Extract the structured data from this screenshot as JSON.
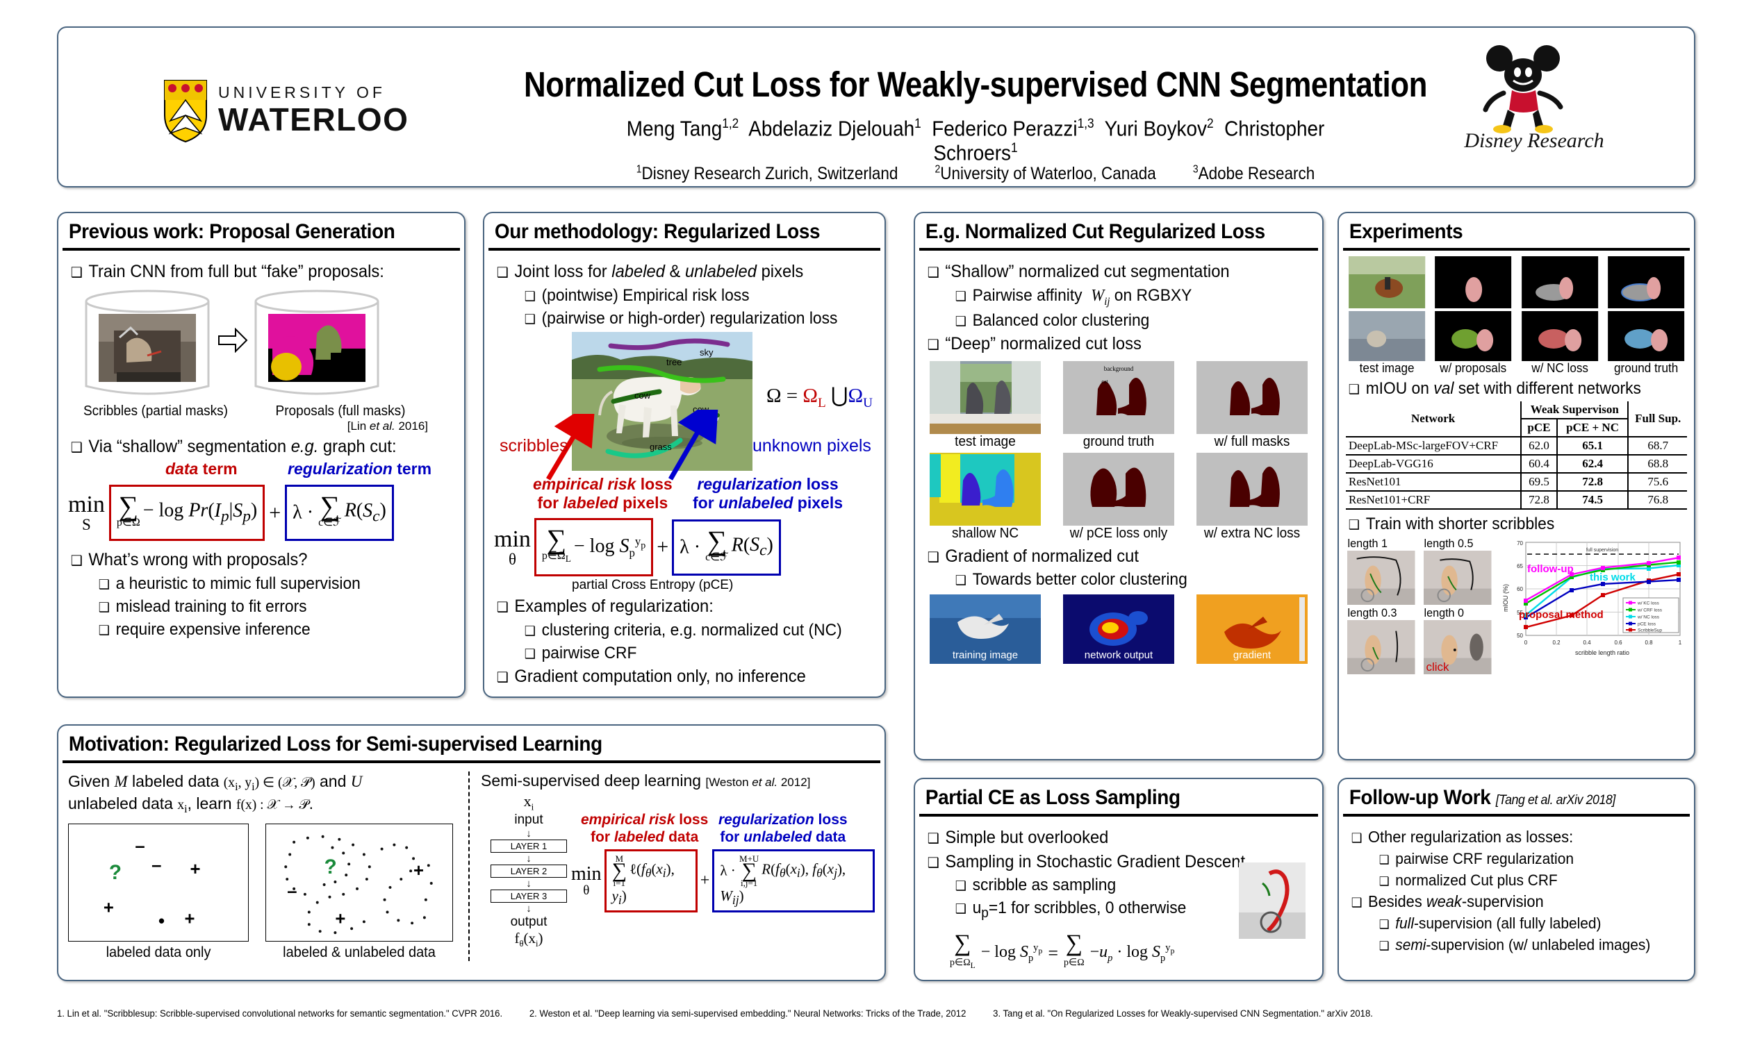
{
  "header": {
    "title": "Normalized Cut Loss for Weakly-supervised CNN Segmentation",
    "authors_line1": "Meng Tang1,2  Abdelaziz Djelouah1  Federico Perazzi1,3  Yuri Boykov2  Christopher",
    "authors_line2": "Schroers1",
    "affiliations": [
      "1Disney Research Zurich, Switzerland",
      "2University of Waterloo, Canada",
      "3Adobe Research"
    ],
    "uw_logo_line1": "UNIVERSITY OF",
    "uw_logo_line2": "WATERLOO",
    "disney_logo_text": "Disney Research"
  },
  "col1": {
    "title": "Previous work: Proposal Generation",
    "bullet1": "Train CNN from full but “fake” proposals:",
    "cap_left": "Scribbles (partial masks)",
    "cap_right": "Proposals (full masks)",
    "cap_right_cite": "[Lin et al. 2016]",
    "bullet2": "Via “shallow” segmentation e.g. graph cut:",
    "label_data": "data term",
    "label_reg": "regularization term",
    "formula_min": "min",
    "formula_sub": "S",
    "formula_red": "∑ − log Pr(Iₚ|Sₚ)",
    "formula_red_sub": "p∈Ω",
    "formula_plus": "+",
    "formula_blue": "λ · ∑ R(Sₑ)",
    "formula_blue_sub": "c∈ℱ",
    "bullet3": "What’s wrong with proposals?",
    "sub1": "a heuristic to mimic full supervision",
    "sub2": "mislead training to fit errors",
    "sub3": "require expensive inference"
  },
  "col2": {
    "title": "Our methodology: Regularized Loss",
    "bullet1": "Joint loss for labeled & unlabeled pixels",
    "sub1": "(pointwise) Empirical risk loss",
    "sub2": "(pairwise or high-order) regularization loss",
    "omega_eq": "Ω = ΩL ⋃ ΩU",
    "img_labels": [
      "sky",
      "tree",
      "cow",
      "cow",
      "grass"
    ],
    "scribbles_label": "scribbles",
    "unknown_label": "unknown pixels",
    "label_emp1": "empirical risk loss",
    "label_emp2": "for labeled pixels",
    "label_reg1": "regularization loss",
    "label_reg2": "for unlabeled pixels",
    "formula_min": "min",
    "formula_sub": "θ",
    "formula_red": "∑ − log Sₚ",
    "formula_red_sup": "yₚ",
    "formula_red_sub": "p∈ΩL",
    "formula_blue": "λ · ∑ R(Sₑ)",
    "formula_blue_sub": "c∈ℱ",
    "pce_caption": "partial Cross Entropy (pCE)",
    "bullet2": "Examples of regularization:",
    "sub3": "clustering criteria, e.g. normalized cut (NC)",
    "sub4": "pairwise CRF",
    "bullet3": "Gradient computation only, no inference"
  },
  "col3": {
    "title": "E.g. Normalized Cut Regularized Loss",
    "bullet1": "“Shallow” normalized cut segmentation",
    "sub1a": "Pairwise affinity ",
    "sub1b": "Wij",
    "sub1c": " on RGBXY",
    "sub2": "Balanced color clustering",
    "bullet2": "“Deep” normalized cut loss",
    "grid_captions": [
      "test image",
      "ground truth",
      "w/ full masks",
      "shallow NC",
      "w/ pCE loss only",
      "w/  extra NC loss"
    ],
    "gt_label": "background",
    "gt_label2": "cat",
    "bullet3": "Gradient of normalized cut",
    "sub3": "Towards better color clustering",
    "bottom_captions": [
      "training image",
      "network output",
      "gradient"
    ]
  },
  "col4": {
    "title": "Experiments",
    "row_captions": [
      "test image",
      "w/  proposals",
      "w/  NC loss",
      "ground truth"
    ],
    "bullet1": "mIOU on val set with different networks",
    "table": {
      "col_network": "Network",
      "col_weak": "Weak Supervison",
      "col_full": "Full Sup.",
      "sub_pce": "pCE",
      "sub_pce_nc": "pCE + NC",
      "rows": [
        {
          "network": "DeepLab-MSc-largeFOV+CRF",
          "pce": "62.0",
          "pce_nc": "65.1",
          "full": "68.7"
        },
        {
          "network": "DeepLab-VGG16",
          "pce": "60.4",
          "pce_nc": "62.4",
          "full": "68.8"
        },
        {
          "network": "ResNet101",
          "pce": "69.5",
          "pce_nc": "72.8",
          "full": "75.6"
        },
        {
          "network": "ResNet101+CRF",
          "pce": "72.8",
          "pce_nc": "74.5",
          "full": "76.8"
        }
      ]
    },
    "bullet2": "Train with shorter scribbles",
    "scribble_labels": [
      "length 1",
      "length 0.5",
      "length 0.3",
      "length 0"
    ],
    "click_label": "click",
    "annot_followup": "follow-up",
    "annot_thiswork": "this work",
    "annot_proposal": "proposal method"
  },
  "chart_data": {
    "type": "line",
    "title": "",
    "xlabel": "scribble length ratio",
    "ylabel": "mIOU (%)",
    "xlim": [
      0,
      1
    ],
    "ylim": [
      50,
      70
    ],
    "xticks": [
      "0",
      "0.2",
      "0.4",
      "0.6",
      "0.8",
      "1"
    ],
    "yticks": [
      "50",
      "55",
      "60",
      "65",
      "70"
    ],
    "grid": true,
    "legend_position": "lower right",
    "annotations": [
      {
        "text": "full supervision",
        "y": 68.7,
        "style": "dashed-line"
      },
      {
        "text": "follow-up",
        "color": "#ff00ff"
      },
      {
        "text": "this work",
        "color": "#00d0e0"
      },
      {
        "text": "proposal method",
        "color": "#d00000"
      }
    ],
    "x": [
      0,
      0.3,
      0.5,
      0.8,
      1
    ],
    "series": [
      {
        "name": "w/ KC loss",
        "color": "#ff00ff",
        "values": [
          57.5,
          63.1,
          64.4,
          65.4,
          66.6
        ]
      },
      {
        "name": "w/ CRF loss",
        "color": "#00c000",
        "values": [
          56.8,
          62.6,
          64.2,
          65.3,
          65.9
        ]
      },
      {
        "name": "w/ NC loss",
        "color": "#00dbe8",
        "values": [
          54.4,
          62.5,
          64.3,
          64.4,
          65.1
        ]
      },
      {
        "name": "pCE loss",
        "color": "#0000c0",
        "values": [
          53.9,
          59.8,
          61.1,
          61.6,
          62.0
        ]
      },
      {
        "name": "ScribbleSup",
        "color": "#d00000",
        "values": [
          51.8,
          54.2,
          58.6,
          61.7,
          63.1
        ]
      }
    ]
  },
  "motivation": {
    "title": "Motivation: Regularized Loss for Semi-supervised Learning",
    "left_text_1": "Given M labeled data (xi, yi) ∈ (𝒳, 𝒴) and U",
    "left_text_2": "unlabeled data xi , learn f(x) : 𝒳 → 𝒴.",
    "cap_left": "labeled data only",
    "cap_right": "labeled & unlabeled data",
    "qmark": "?",
    "right_title": "Semi-supervised deep learning",
    "right_cite": "[Weston et al. 2012]",
    "input_var": "xi",
    "input_label": "input",
    "layers": [
      "LAYER 1",
      "LAYER 2",
      "LAYER 3"
    ],
    "output_label": "output",
    "output_var": "fθ(xi)",
    "label_emp1": "empirical risk loss",
    "label_emp2": "for labeled data",
    "label_reg1": "regularization loss",
    "label_reg2": "for unlabeled data",
    "formula_min": "min",
    "formula_sub": "θ",
    "formula_red": "∑ ℓ(fθ(xi), yi)",
    "formula_red_sup": "M",
    "formula_red_sub": "i=1",
    "formula_blue": "λ · ∑ R(fθ(xi), fθ(xj), Wij)",
    "formula_blue_sup": "M+U",
    "formula_blue_sub": "i,j=1"
  },
  "partialce": {
    "title": "Partial CE as Loss Sampling",
    "bullet1": "Simple but overlooked",
    "bullet2": "Sampling in Stochastic Gradient Descent",
    "sub1": "scribble as sampling",
    "sub2": "up=1 for scribbles, 0 otherwise",
    "formula": "∑ − log Sₚ  =  ∑ −uₚ · log Sₚ",
    "formula_sub_left": "p∈ΩL",
    "formula_sub_right": "p∈Ω"
  },
  "followup": {
    "title": "Follow-up Work",
    "cite": "[Tang et al. arXiv 2018]",
    "bullet1": "Other regularization as losses:",
    "sub1": "pairwise CRF regularization",
    "sub2": "normalized Cut plus CRF",
    "bullet2": "Besides weak-supervision",
    "sub3": "full-supervision (all fully labeled)",
    "sub4": "semi-supervision (w/ unlabeled images)"
  },
  "references": [
    "1. Lin et al. \"Scribblesup: Scribble-supervised convolutional networks for semantic segmentation.\" CVPR 2016.",
    "2. Weston et al. \"Deep learning via semi-supervised embedding.\" Neural Networks: Tricks of the Trade, 2012",
    "3. Tang et al. \"On Regularized Losses for Weakly-supervised CNN Segmentation.\"  arXiv 2018."
  ],
  "colors": {
    "panel_border": "#4a6580",
    "red": "#c00000",
    "blue": "#0000c0",
    "magenta": "#ff00ff",
    "cyan": "#00dbe8",
    "green": "#00c000"
  }
}
